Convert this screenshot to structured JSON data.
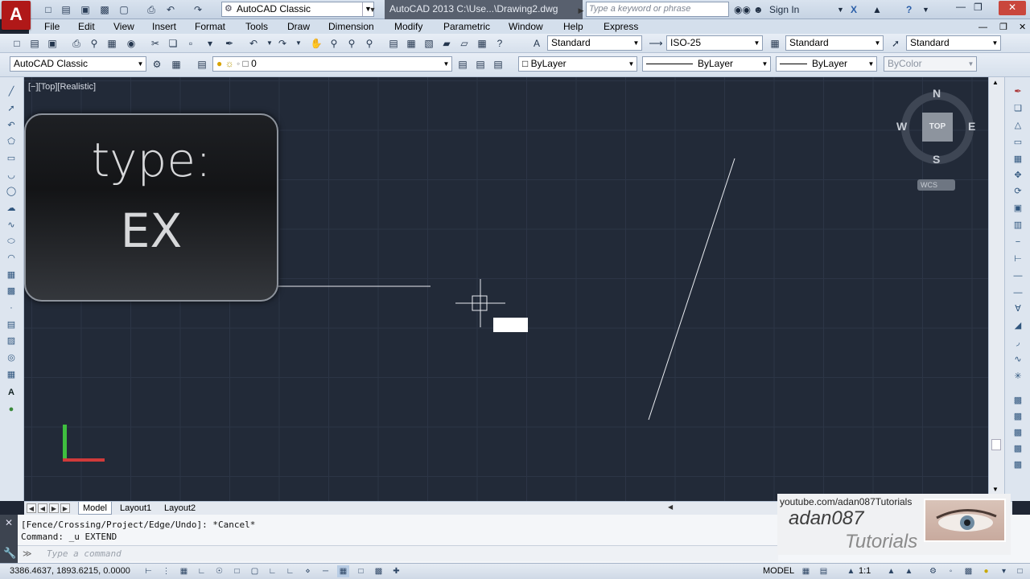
{
  "titlebar": {
    "app_logo": "A",
    "workspace": "AutoCAD Classic",
    "document_title": "AutoCAD 2013    C:\\Use...\\Drawing2.dwg",
    "search_placeholder": "Type a keyword or phrase",
    "sign_in": "Sign In"
  },
  "menu": [
    "File",
    "Edit",
    "View",
    "Insert",
    "Format",
    "Tools",
    "Draw",
    "Dimension",
    "Modify",
    "Parametric",
    "Window",
    "Help",
    "Express"
  ],
  "styles": {
    "text_style": "Standard",
    "dim_style": "ISO-25",
    "table_style": "Standard",
    "multileader_style": "Standard"
  },
  "workspace_combo": "AutoCAD Classic",
  "layer_combo": "0",
  "properties": {
    "color": "ByLayer",
    "linetype": "ByLayer",
    "lineweight": "ByLayer",
    "plotstyle": "ByColor"
  },
  "viewport_label": "[−][Top][Realistic]",
  "overlay": {
    "line1": "type:",
    "line2": "EX"
  },
  "viewcube": {
    "north": "N",
    "south": "S",
    "east": "E",
    "west": "W",
    "face": "TOP",
    "wcs": "WCS"
  },
  "tabs": [
    "Model",
    "Layout1",
    "Layout2"
  ],
  "command_history": [
    "[Fence/Crossing/Project/Edge/Undo]: *Cancel*",
    "Command: _u EXTEND"
  ],
  "command_placeholder": "Type a command",
  "status": {
    "coordinates": "3386.4637, 1893.6215, 0.0000",
    "model_label": "MODEL",
    "scale": "1:1"
  },
  "watermark": {
    "url": "youtube.com/adan087Tutorials",
    "name": "adan087",
    "sub": "Tutorials"
  },
  "colors": {
    "canvas": "#222a38",
    "grid": "#2c3546",
    "title_logo": "#b01818",
    "ucs_y": "#3fbf3f",
    "ucs_x": "#d03a3a"
  }
}
